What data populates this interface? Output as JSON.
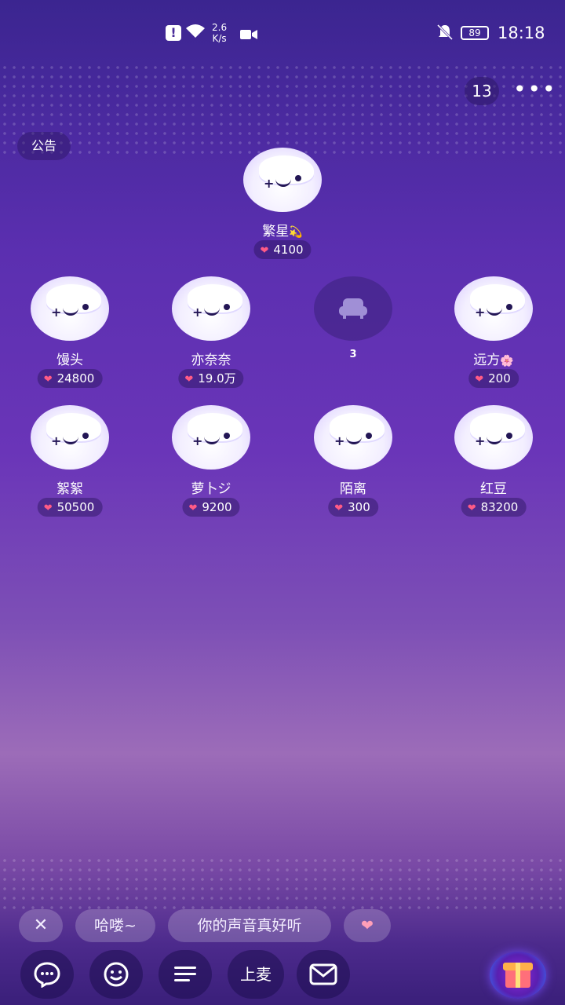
{
  "statusbar": {
    "speed_value": "2.6",
    "speed_unit": "K/s",
    "battery": "89",
    "time": "18:18"
  },
  "room": {
    "online_count": "13",
    "notice_label": "公告"
  },
  "host": {
    "name": "繁星",
    "badge": "💫",
    "score": "4100"
  },
  "seats_row1": [
    {
      "name": "馒头",
      "badge": "",
      "score": "24800"
    },
    {
      "name": "亦奈奈",
      "badge": "",
      "score": "19.0万"
    },
    {
      "name": "3",
      "badge": "",
      "score": ""
    },
    {
      "name": "远方",
      "badge": "🌸",
      "score": "200"
    }
  ],
  "seats_row2": [
    {
      "name": "絮絮",
      "badge": "",
      "score": "50500"
    },
    {
      "name": "萝卜ジ",
      "badge": "",
      "score": "9200"
    },
    {
      "name": "陌离",
      "badge": "",
      "score": "300"
    },
    {
      "name": "红豆",
      "badge": "",
      "score": "83200"
    }
  ],
  "quick_replies": [
    "哈喽~",
    "你的声音真好听",
    "❤"
  ],
  "bottom_bar": {
    "mic_label": "上麦"
  },
  "icons": [
    "alert-icon",
    "wifi-icon",
    "video-icon",
    "bell-off-icon",
    "more-icon",
    "close-icon",
    "chat-icon",
    "emoji-icon",
    "menu-icon",
    "mail-icon",
    "gift-icon",
    "heart-icon",
    "sofa-icon"
  ]
}
